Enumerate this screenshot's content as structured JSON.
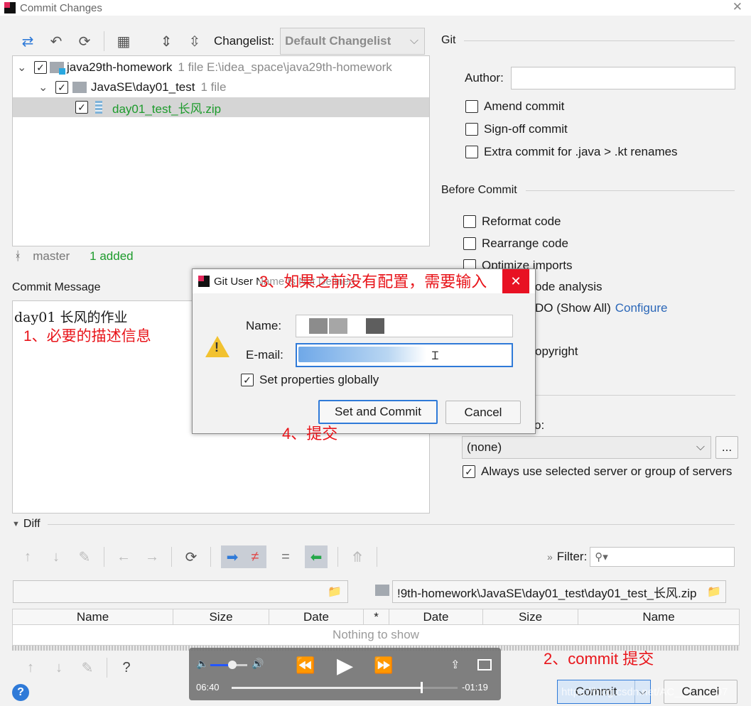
{
  "window": {
    "title": "Commit Changes",
    "close_glyph": "✕"
  },
  "toolbar": {
    "changelist_label": "Changelist:",
    "changelist_value": "Default Changelist"
  },
  "tree": [
    {
      "label": "java29th-homework",
      "meta": "1 file  E:\\idea_space\\java29th-homework"
    },
    {
      "label": "JavaSE\\day01_test",
      "meta": "1 file"
    },
    {
      "label": "day01_test_长风.zip"
    }
  ],
  "status": {
    "branch": "master",
    "added": "1 added"
  },
  "commit_message": {
    "heading": "Commit Message",
    "text": "day01 长风的作业",
    "annotation": "1、必要的描述信息"
  },
  "git": {
    "heading": "Git",
    "author_label": "Author:",
    "author_value": "",
    "options": [
      "Amend commit",
      "Sign-off commit",
      "Extra commit for .java > .kt renames"
    ]
  },
  "before_commit": {
    "heading": "Before Commit",
    "options": [
      "Reformat code",
      "Rearrange code",
      "Optimize imports",
      "ode analysis",
      "DO (Show All)",
      "opyright"
    ],
    "configure_link": "Configure"
  },
  "after_commit": {
    "upload_label": "o:",
    "server_value": "(none)",
    "more_button": "...",
    "always_label": "Always use selected server or group of servers"
  },
  "diff": {
    "heading": "Diff",
    "filter_label": "Filter:",
    "right_path": "!9th-homework\\JavaSE\\day01_test\\day01_test_长风.zip",
    "columns": [
      "Name",
      "Size",
      "Date",
      "*",
      "Date",
      "Size",
      "Name"
    ],
    "empty_text": "Nothing to show"
  },
  "dialog": {
    "title": "Git User Name Is Not Defined",
    "annotation_title": "3、如果之前没有配置，需要输入",
    "name_label": "Name:",
    "email_label": "E-mail:",
    "name_value": "",
    "email_value": "",
    "global_label": "Set properties globally",
    "set_commit_button": "Set and Commit",
    "cancel_button": "Cancel",
    "close_glyph": "✕"
  },
  "annotations": {
    "submit": "4、提交",
    "commit": "2、commit 提交"
  },
  "bottom": {
    "commit_button": "Commit",
    "cancel_button": "Cancel",
    "help": "?",
    "watermark": "https://blog.csdn.net/AC_______07"
  },
  "media": {
    "elapsed": "06:40",
    "remaining": "-01:19",
    "volume": 0.6,
    "progress": 0.84
  },
  "colors": {
    "accent_red": "#e8141a",
    "added_green": "#1d9b2c",
    "link_blue": "#2b67b8",
    "dialog_close": "#e81123"
  }
}
